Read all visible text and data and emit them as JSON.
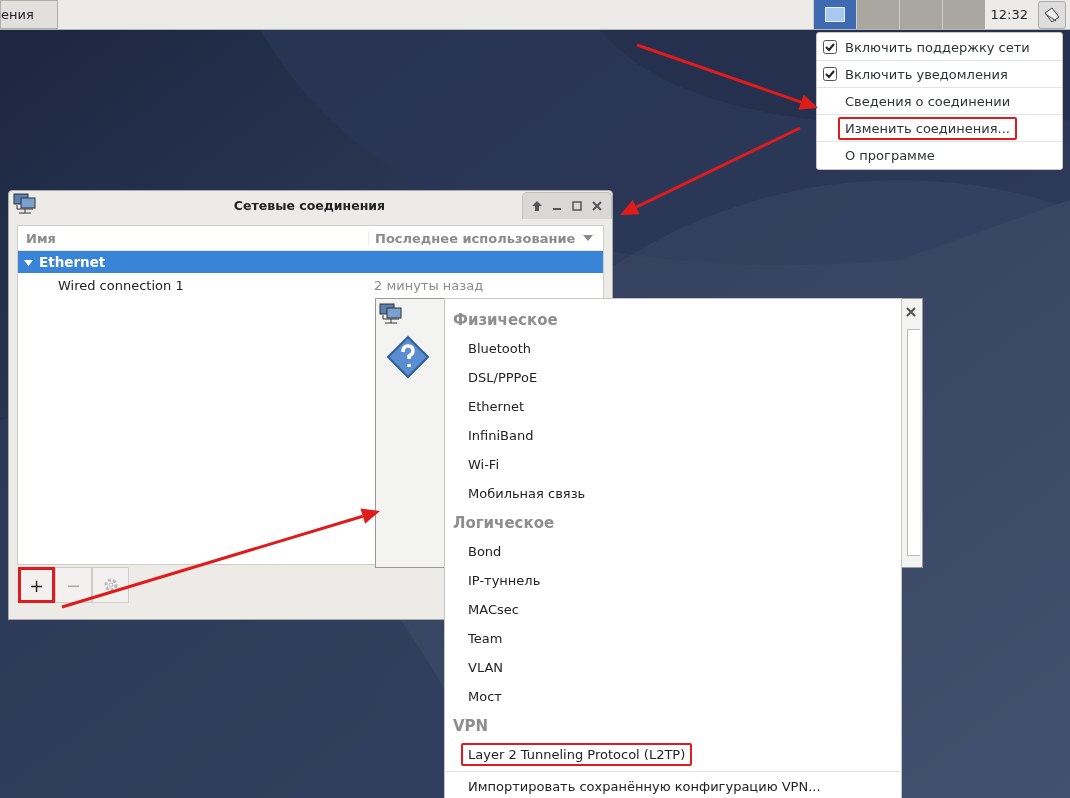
{
  "panel": {
    "taskbar_button": "ения",
    "workspaces": [
      {
        "selected": true
      },
      {
        "selected": false
      },
      {
        "selected": false
      },
      {
        "selected": false
      }
    ],
    "clock": "12:32"
  },
  "tray_menu": {
    "items": [
      {
        "kind": "check",
        "label": "Включить поддержку сети",
        "checked": true,
        "highlighted": false
      },
      {
        "kind": "check",
        "label": "Включить уведомления",
        "checked": true,
        "highlighted": false
      },
      {
        "kind": "plain",
        "label": "Сведения о соединении",
        "highlighted": false
      },
      {
        "kind": "plain",
        "label": "Изменить соединения...",
        "highlighted": true
      },
      {
        "kind": "plain",
        "label": "О программе",
        "highlighted": false
      }
    ]
  },
  "main_window": {
    "title": "Сетевые соединения",
    "columns": [
      "Имя",
      "Последнее использование"
    ],
    "groups": [
      {
        "label": "Ethernet",
        "expanded": true,
        "selected": true,
        "rows": [
          {
            "name": "Wired connection 1",
            "last_used": "2 минуты назад"
          }
        ]
      }
    ],
    "toolbar": [
      {
        "kind": "add",
        "label": "+",
        "disabled": false,
        "highlighted": true
      },
      {
        "kind": "remove",
        "label": "−",
        "disabled": true,
        "highlighted": false
      },
      {
        "kind": "settings",
        "disabled": true,
        "highlighted": false
      }
    ]
  },
  "type_menu": {
    "sections": [
      {
        "title": "Физическое",
        "items": [
          {
            "label": "Bluetooth",
            "highlighted": false
          },
          {
            "label": "DSL/PPPoE",
            "highlighted": false
          },
          {
            "label": "Ethernet",
            "highlighted": false
          },
          {
            "label": "InfiniBand",
            "highlighted": false
          },
          {
            "label": "Wi-Fi",
            "highlighted": false
          },
          {
            "label": "Мобильная связь",
            "highlighted": false
          }
        ]
      },
      {
        "title": "Логическое",
        "items": [
          {
            "label": "Bond",
            "highlighted": false
          },
          {
            "label": "IP-туннель",
            "highlighted": false
          },
          {
            "label": "MACsec",
            "highlighted": false
          },
          {
            "label": "Team",
            "highlighted": false
          },
          {
            "label": "VLAN",
            "highlighted": false
          },
          {
            "label": "Мост",
            "highlighted": false
          }
        ]
      },
      {
        "title": "VPN",
        "items": [
          {
            "label": "Layer 2 Tunneling Protocol (L2TP)",
            "highlighted": true
          }
        ]
      }
    ],
    "footer": "Импортировать сохранённую конфигурацию VPN..."
  }
}
